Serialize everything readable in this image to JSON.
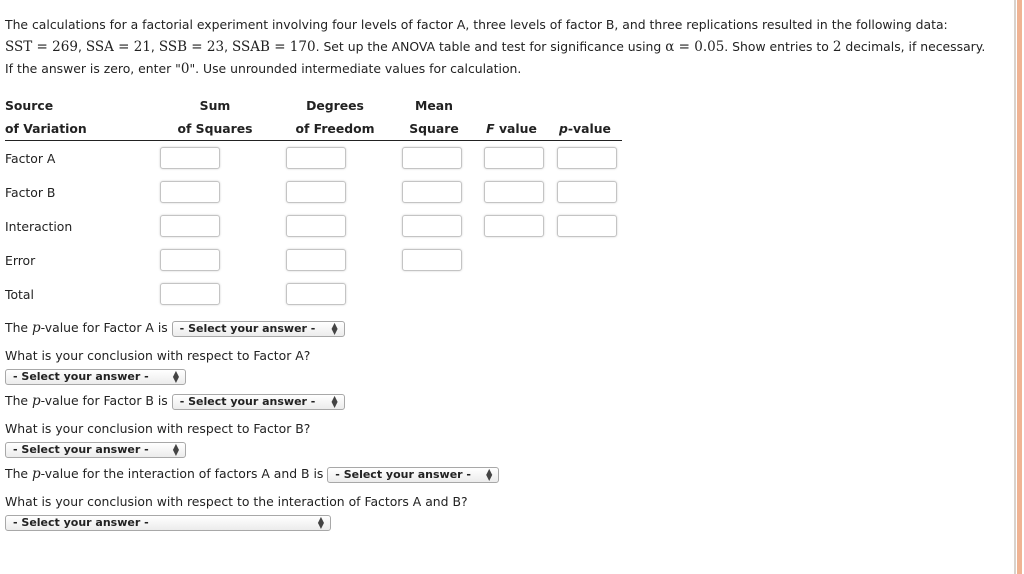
{
  "intro": {
    "line1": "The calculations for a factorial experiment involving four levels of factor A, three levels of factor B, and three replications resulted in the following data:",
    "sst": "SST = 269",
    "ssa": "SSA = 21",
    "ssb": "SSB = 23",
    "ssab": "SSAB = 170",
    "line2_text": ". Set up the ANOVA table and test for significance using ",
    "alpha": "α = 0.05",
    "line2_text2": ". Show entries to ",
    "decimals": "2",
    "line2_text3": " decimals, if necessary.",
    "line3_a": "If the answer is zero, enter \"",
    "zero": "0",
    "line3_b": "\". Use unrounded intermediate values for calculation."
  },
  "table": {
    "headers_top": [
      "Source",
      "Sum",
      "Degrees",
      "Mean",
      "",
      ""
    ],
    "headers_bottom": [
      "of Variation",
      "of Squares",
      "of Freedom",
      "Square",
      "value",
      "-value"
    ],
    "f_prefix": "F",
    "p_prefix": "p",
    "rows": [
      {
        "label": "Factor A",
        "ss": "",
        "df": "",
        "ms": "",
        "f": "",
        "p": ""
      },
      {
        "label": "Factor B",
        "ss": "",
        "df": "",
        "ms": "",
        "f": "",
        "p": ""
      },
      {
        "label": "Interaction",
        "ss": "",
        "df": "",
        "ms": "",
        "f": "",
        "p": ""
      },
      {
        "label": "Error",
        "ss": "",
        "df": "",
        "ms": ""
      },
      {
        "label": "Total",
        "ss": "",
        "df": ""
      }
    ]
  },
  "questions": {
    "pA_prefix": "The ",
    "p": "p",
    "pA_suffix": "-value for Factor A is",
    "concA": "What is your conclusion with respect to Factor A?",
    "pB_suffix": "-value for Factor B is",
    "concB": "What is your conclusion with respect to Factor B?",
    "pAB_suffix": "-value for the interaction of factors A and B is",
    "concAB": "What is your conclusion with respect to the interaction of Factors A and B?",
    "select_placeholder": "- Select your answer -"
  },
  "icons": {
    "select_arrows_up": "▲",
    "select_arrows_down": "▼"
  }
}
